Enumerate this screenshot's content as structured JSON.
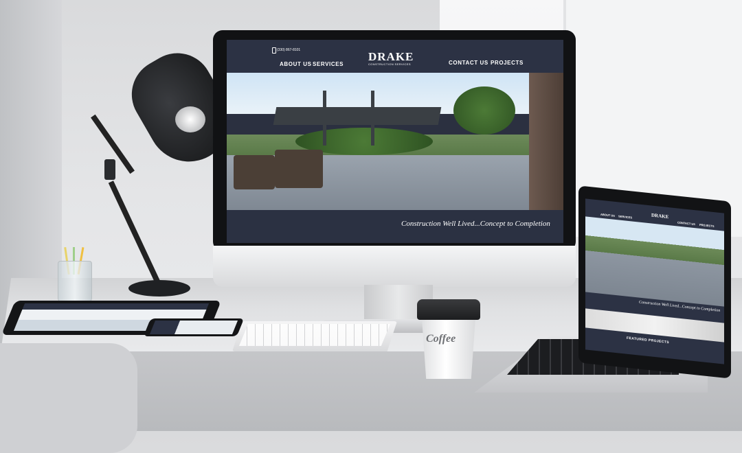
{
  "website": {
    "phone": "(330) 867-8101",
    "logo": "DRAKE",
    "logo_sub": "CONSTRUCTION SERVICES",
    "nav_left": [
      "ABOUT US",
      "SERVICES"
    ],
    "nav_right": [
      "CONTACT US",
      "PROJECTS"
    ],
    "tagline": "Construction Well Lived...Concept to Completion"
  },
  "laptop_site": {
    "logo": "DRAKE",
    "nav": [
      "ABOUT US",
      "SERVICES",
      "CONTACT US",
      "PROJECTS"
    ],
    "tagline": "Construction Well Lived...Concept to Completion",
    "featured": "FEATURED PROJECTS"
  },
  "coffee": {
    "label": "Coffee"
  }
}
